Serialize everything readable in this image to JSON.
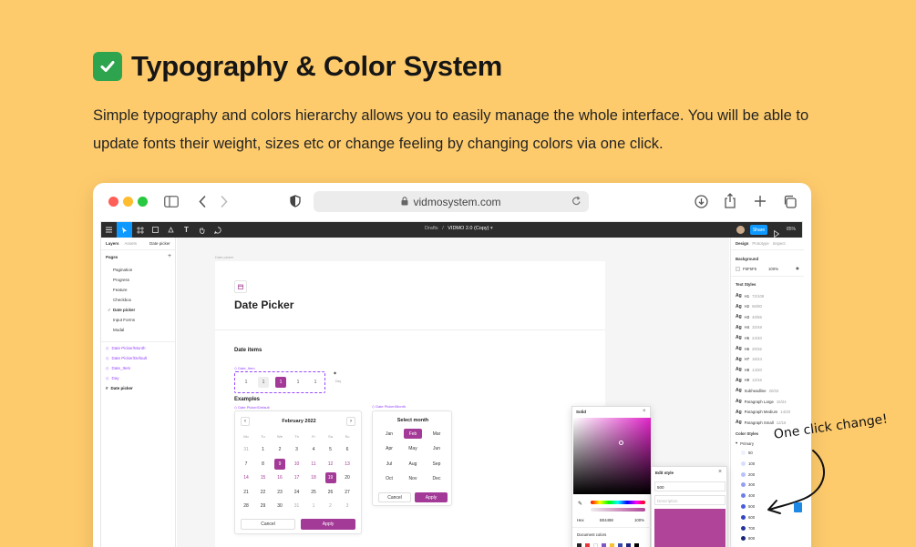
{
  "hero": {
    "title": "Typography & Color System",
    "description": "Simple typography and colors hierarchy allows you to easily manage the whole interface. You will be able to update fonts their weight, sizes etc or change feeling by changing colors via one click."
  },
  "browser": {
    "url": "vidmosystem.com"
  },
  "figma": {
    "breadcrumb_project": "Drafts",
    "file_name": "VIDMO 2.0 (Copy)",
    "share_label": "Share",
    "zoom": "85%",
    "left_tabs": [
      "Layers",
      "Assets",
      "Date picker"
    ],
    "pages_label": "Pages",
    "pages": [
      "Pagination",
      "Progress",
      "Feature",
      "Checkbox",
      "Date picker",
      "Input Forms",
      "Modal"
    ],
    "layers": [
      "Date Picker/Month",
      "Date Picker/Default",
      "Date_Item",
      "Day",
      "Date picker"
    ],
    "right_tabs": [
      "Design",
      "Prototype",
      "Inspect"
    ],
    "background_label": "Background",
    "background_hex": "F5F5F5",
    "background_opacity": "100%",
    "text_styles_label": "Text Styles",
    "text_styles": [
      {
        "name": "H1",
        "spec": "72/108"
      },
      {
        "name": "H2",
        "spec": "56/80"
      },
      {
        "name": "H3",
        "spec": "40/56"
      },
      {
        "name": "H4",
        "spec": "32/48"
      },
      {
        "name": "H5",
        "spec": "24/40"
      },
      {
        "name": "H6",
        "spec": "20/32"
      },
      {
        "name": "H7",
        "spec": "16/24"
      },
      {
        "name": "H8",
        "spec": "14/20"
      },
      {
        "name": "H9",
        "spec": "12/16"
      },
      {
        "name": "Subheadline",
        "spec": "20/32"
      },
      {
        "name": "Paragraph Large",
        "spec": "16/24"
      },
      {
        "name": "Paragraph Medium",
        "spec": "14/20"
      },
      {
        "name": "Paragraph Small",
        "spec": "12/16"
      }
    ],
    "color_styles_label": "Color Styles",
    "color_group": "Primary",
    "color_swatches": [
      {
        "label": "50",
        "color": "#EEF0FF"
      },
      {
        "label": "100",
        "color": "#D9DEFF"
      },
      {
        "label": "200",
        "color": "#B8C1FF"
      },
      {
        "label": "300",
        "color": "#929FF5"
      },
      {
        "label": "400",
        "color": "#6D7EEB"
      },
      {
        "label": "500",
        "color": "#4A5DDC"
      },
      {
        "label": "600",
        "color": "#3445C2"
      },
      {
        "label": "700",
        "color": "#26349E"
      },
      {
        "label": "800",
        "color": "#1B2578"
      }
    ]
  },
  "canvas": {
    "frame_label": "Date picker",
    "page_title": "Date Picker",
    "date_items_label": "Date items",
    "date_item_tag": "Date_Item",
    "date_item_values": [
      "1",
      "1",
      "1",
      "1",
      "1"
    ],
    "date_item_side": "Day",
    "examples_label": "Examples",
    "default_tag": "Date Picker/Default",
    "month_tag": "Date Picker/Month",
    "calendar_month": "February 2022",
    "weekdays": [
      "Mo",
      "Tu",
      "We",
      "Th",
      "Fr",
      "Sa",
      "Su"
    ],
    "calendar_rows": [
      [
        "31",
        "1",
        "2",
        "3",
        "4",
        "5",
        "6"
      ],
      [
        "7",
        "8",
        "9",
        "10",
        "11",
        "12",
        "13"
      ],
      [
        "14",
        "15",
        "16",
        "17",
        "18",
        "19",
        "20"
      ],
      [
        "21",
        "22",
        "23",
        "24",
        "25",
        "26",
        "27"
      ],
      [
        "28",
        "29",
        "30",
        "31",
        "1",
        "2",
        "3"
      ]
    ],
    "cancel_label": "Cancel",
    "apply_label": "Apply",
    "select_month_label": "Select month",
    "months": [
      "Jan",
      "Feb",
      "Mar",
      "Apr",
      "May",
      "Jun",
      "Jul",
      "Aug",
      "Sep",
      "Oct",
      "Nov",
      "Dec"
    ],
    "selected_month": "Feb",
    "accent": "#A33A97"
  },
  "color_picker": {
    "mode": "Solid",
    "hex_label": "Hex",
    "hex_value": "B04498",
    "opacity": "100%",
    "document_colors": "Document colors"
  },
  "edit_style": {
    "title": "Edit style",
    "name_value": "500",
    "description_placeholder": "Description"
  },
  "annotation": "One  click change!"
}
